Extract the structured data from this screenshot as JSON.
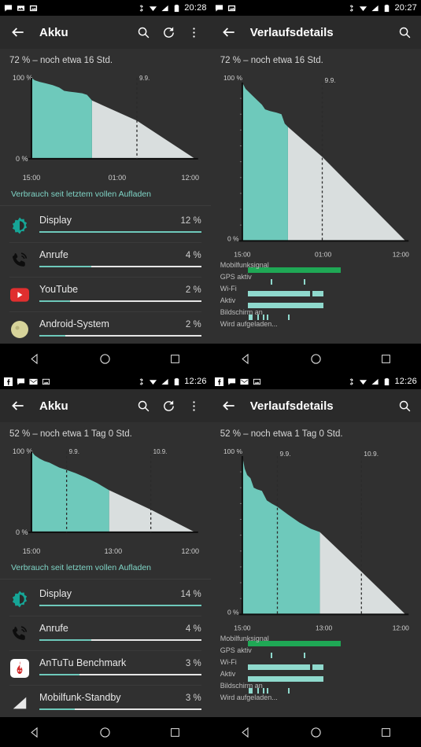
{
  "screens": [
    {
      "id": "screen-top-left",
      "statusbar": {
        "icons": [
          "message-icon",
          "image-icon",
          "photo-icon"
        ],
        "right_icons": [
          "bluetooth-icon",
          "wifi-icon",
          "signal-icon",
          "battery-icon"
        ],
        "time": "20:28"
      },
      "toolbar": {
        "back_icon": "back-arrow-icon",
        "title": "Akku",
        "actions": [
          "search-icon",
          "refresh-icon",
          "overflow-menu-icon"
        ]
      },
      "summary": "72 % – noch etwa 16 Std.",
      "usage_note": "Verbrauch seit letztem vollen Aufladen",
      "apps": [
        {
          "icon": "display-brightness-icon",
          "name": "Display",
          "percent": "12 %",
          "bar": 100
        },
        {
          "icon": "phone-call-icon",
          "name": "Anrufe",
          "percent": "4 %",
          "bar": 32
        },
        {
          "icon": "youtube-icon",
          "name": "YouTube",
          "percent": "2 %",
          "bar": 19
        },
        {
          "icon": "android-system-icon",
          "name": "Android-System",
          "percent": "2 %",
          "bar": 16
        }
      ]
    },
    {
      "id": "screen-top-right",
      "statusbar": {
        "icons": [
          "message-icon",
          "photo-icon"
        ],
        "right_icons": [
          "bluetooth-icon",
          "wifi-icon",
          "signal-icon",
          "battery-icon"
        ],
        "time": "20:27"
      },
      "toolbar": {
        "back_icon": "back-arrow-icon",
        "title": "Verlaufsdetails",
        "actions": [
          "search-icon"
        ]
      },
      "summary": "72 % – noch etwa 16 Std.",
      "legend": [
        {
          "label": "Mobilfunksignal",
          "color": "#1fa855"
        },
        {
          "label": "GPS aktiv",
          "color": "#8fd9cd"
        },
        {
          "label": "Wi-Fi",
          "color": "#8fd9cd"
        },
        {
          "label": "Aktiv",
          "color": "#8fd9cd"
        },
        {
          "label": "Bildschirm an",
          "color": "#8fd9cd"
        },
        {
          "label": "Wird aufgeladen...",
          "color": "#8fd9cd"
        }
      ]
    },
    {
      "id": "screen-bottom-left",
      "statusbar": {
        "icons": [
          "facebook-icon",
          "message-icon",
          "gmail-icon",
          "image-icon"
        ],
        "right_icons": [
          "bluetooth-icon",
          "wifi-icon",
          "signal-icon",
          "battery-icon"
        ],
        "time": "12:26"
      },
      "toolbar": {
        "back_icon": "back-arrow-icon",
        "title": "Akku",
        "actions": [
          "search-icon",
          "refresh-icon",
          "overflow-menu-icon"
        ]
      },
      "summary": "52 % – noch etwa 1 Tag 0 Std.",
      "usage_note": "Verbrauch seit letztem vollen Aufladen",
      "apps": [
        {
          "icon": "display-brightness-icon",
          "name": "Display",
          "percent": "14 %",
          "bar": 100
        },
        {
          "icon": "phone-call-icon",
          "name": "Anrufe",
          "percent": "4 %",
          "bar": 32
        },
        {
          "icon": "antutu-icon",
          "name": "AnTuTu Benchmark",
          "percent": "3 %",
          "bar": 25
        },
        {
          "icon": "mobile-signal-icon",
          "name": "Mobilfunk-Standby",
          "percent": "3 %",
          "bar": 22
        }
      ]
    },
    {
      "id": "screen-bottom-right",
      "statusbar": {
        "icons": [
          "facebook-icon",
          "message-icon",
          "gmail-icon",
          "image-icon"
        ],
        "right_icons": [
          "bluetooth-icon",
          "wifi-icon",
          "signal-icon",
          "battery-icon"
        ],
        "time": "12:26"
      },
      "toolbar": {
        "back_icon": "back-arrow-icon",
        "title": "Verlaufsdetails",
        "actions": [
          "search-icon"
        ]
      },
      "summary": "52 % – noch etwa 1 Tag 0 Std.",
      "legend": [
        {
          "label": "Mobilfunksignal",
          "color": "#1fa855"
        },
        {
          "label": "GPS aktiv",
          "color": "#8fd9cd"
        },
        {
          "label": "Wi-Fi",
          "color": "#8fd9cd"
        },
        {
          "label": "Aktiv",
          "color": "#8fd9cd"
        },
        {
          "label": "Bildschirm an",
          "color": "#8fd9cd"
        },
        {
          "label": "Wird aufgeladen...",
          "color": "#8fd9cd"
        }
      ]
    }
  ],
  "navbar": {
    "back_label": "back-button",
    "home_label": "home-button",
    "recents_label": "recents-button"
  },
  "colors": {
    "accent_teal": "#6ec9bb",
    "projection_grey": "#d9dede",
    "background": "#303030",
    "toolbar": "#2a2a2a",
    "statusbar": "#000000",
    "signal_green": "#1fa855",
    "link_teal": "#7fd4c6"
  },
  "chart_data": [
    {
      "id": "chart-top-left",
      "type": "area",
      "title": "72 % – noch etwa 16 Std.",
      "ylabel_top": "100 %",
      "ylabel_bottom": "0 %",
      "ylim": [
        0,
        100
      ],
      "grid": false,
      "xticks": [
        "15:00",
        "01:00",
        "12:00"
      ],
      "day_markers": [
        "9.9."
      ],
      "day_marker_positions": [
        0.645
      ],
      "history_split": 0.37,
      "history": [
        {
          "x": 0.0,
          "y": 100
        },
        {
          "x": 0.02,
          "y": 97
        },
        {
          "x": 0.05,
          "y": 95
        },
        {
          "x": 0.09,
          "y": 93
        },
        {
          "x": 0.13,
          "y": 91
        },
        {
          "x": 0.17,
          "y": 88
        },
        {
          "x": 0.2,
          "y": 84
        },
        {
          "x": 0.23,
          "y": 83
        },
        {
          "x": 0.27,
          "y": 82
        },
        {
          "x": 0.31,
          "y": 81
        },
        {
          "x": 0.34,
          "y": 79
        },
        {
          "x": 0.37,
          "y": 72
        }
      ],
      "projection": [
        {
          "x": 0.37,
          "y": 72
        },
        {
          "x": 0.645,
          "y": 47
        },
        {
          "x": 1.0,
          "y": 0
        }
      ]
    },
    {
      "id": "chart-top-right",
      "type": "area",
      "title": "72 % – noch etwa 16 Std.",
      "ylabel_top": "100 %",
      "ylabel_bottom": "0 %",
      "ylim": [
        0,
        100
      ],
      "grid": false,
      "xticks": [
        "15:00",
        "01:00",
        "12:00"
      ],
      "day_markers": [
        "9.9."
      ],
      "day_marker_positions": [
        0.49
      ],
      "history_split": 0.28,
      "history": [
        {
          "x": 0.0,
          "y": 100
        },
        {
          "x": 0.02,
          "y": 96
        },
        {
          "x": 0.04,
          "y": 94
        },
        {
          "x": 0.06,
          "y": 92
        },
        {
          "x": 0.09,
          "y": 89
        },
        {
          "x": 0.12,
          "y": 86
        },
        {
          "x": 0.14,
          "y": 83
        },
        {
          "x": 0.17,
          "y": 82
        },
        {
          "x": 0.21,
          "y": 81
        },
        {
          "x": 0.24,
          "y": 80
        },
        {
          "x": 0.26,
          "y": 74
        },
        {
          "x": 0.28,
          "y": 72
        }
      ],
      "projection": [
        {
          "x": 0.28,
          "y": 72
        },
        {
          "x": 0.49,
          "y": 53
        },
        {
          "x": 1.0,
          "y": 0
        }
      ]
    },
    {
      "id": "chart-bottom-left",
      "type": "area",
      "title": "52 % – noch etwa 1 Tag 0 Std.",
      "ylabel_top": "100 %",
      "ylabel_bottom": "0 %",
      "ylim": [
        0,
        100
      ],
      "grid": false,
      "xticks": [
        "15:00",
        "13:00",
        "12:00"
      ],
      "day_markers": [
        "9.9.",
        "10.9."
      ],
      "day_marker_positions": [
        0.215,
        0.73
      ],
      "history_split": 0.475,
      "history": [
        {
          "x": 0.0,
          "y": 100
        },
        {
          "x": 0.02,
          "y": 95
        },
        {
          "x": 0.05,
          "y": 91
        },
        {
          "x": 0.08,
          "y": 88
        },
        {
          "x": 0.11,
          "y": 86
        },
        {
          "x": 0.14,
          "y": 83
        },
        {
          "x": 0.17,
          "y": 80
        },
        {
          "x": 0.215,
          "y": 77
        },
        {
          "x": 0.27,
          "y": 73
        },
        {
          "x": 0.33,
          "y": 68
        },
        {
          "x": 0.4,
          "y": 61
        },
        {
          "x": 0.475,
          "y": 52
        }
      ],
      "projection": [
        {
          "x": 0.475,
          "y": 52
        },
        {
          "x": 0.73,
          "y": 28
        },
        {
          "x": 1.0,
          "y": 0
        }
      ]
    },
    {
      "id": "chart-bottom-right",
      "type": "area",
      "title": "52 % – noch etwa 1 Tag 0 Std.",
      "ylabel_top": "100 %",
      "ylabel_bottom": "0 %",
      "ylim": [
        0,
        100
      ],
      "grid": false,
      "xticks": [
        "15:00",
        "13:00",
        "12:00"
      ],
      "day_markers": [
        "9.9.",
        "10.9."
      ],
      "day_marker_positions": [
        0.215,
        0.73
      ],
      "history_split": 0.475,
      "history": [
        {
          "x": 0.0,
          "y": 100
        },
        {
          "x": 0.015,
          "y": 92
        },
        {
          "x": 0.03,
          "y": 88
        },
        {
          "x": 0.05,
          "y": 86
        },
        {
          "x": 0.07,
          "y": 80
        },
        {
          "x": 0.09,
          "y": 79
        },
        {
          "x": 0.12,
          "y": 78
        },
        {
          "x": 0.15,
          "y": 72
        },
        {
          "x": 0.18,
          "y": 70
        },
        {
          "x": 0.215,
          "y": 68
        },
        {
          "x": 0.28,
          "y": 63
        },
        {
          "x": 0.35,
          "y": 58
        },
        {
          "x": 0.42,
          "y": 54
        },
        {
          "x": 0.475,
          "y": 52
        }
      ],
      "projection": [
        {
          "x": 0.475,
          "y": 52
        },
        {
          "x": 0.73,
          "y": 27
        },
        {
          "x": 1.0,
          "y": 0
        }
      ]
    }
  ],
  "legend_bars": {
    "mobilfunksignal": [
      {
        "start": 0.05,
        "end": 0.6
      }
    ],
    "gps": [
      {
        "start": 0.185,
        "end": 0.195
      },
      {
        "start": 0.38,
        "end": 0.39
      }
    ],
    "wifi": [
      {
        "start": 0.05,
        "end": 0.42
      },
      {
        "start": 0.435,
        "end": 0.5
      }
    ],
    "aktiv": [
      {
        "start": 0.05,
        "end": 0.5
      }
    ],
    "bildschirm": [
      {
        "start": 0.055,
        "end": 0.08
      },
      {
        "start": 0.11,
        "end": 0.118
      },
      {
        "start": 0.14,
        "end": 0.148
      },
      {
        "start": 0.165,
        "end": 0.175
      },
      {
        "start": 0.29,
        "end": 0.3
      }
    ],
    "wird_aufgeladen": []
  }
}
